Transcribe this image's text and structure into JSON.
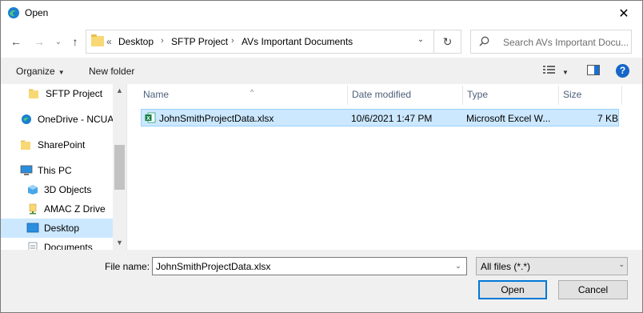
{
  "window": {
    "title": "Open",
    "close_glyph": "✕"
  },
  "nav": {
    "back_glyph": "←",
    "forward_glyph": "→",
    "recent_glyph": "⌄",
    "up_glyph": "↑",
    "breadcrumb_overflow": "«",
    "breadcrumbs": [
      "Desktop",
      "SFTP Project",
      "AVs Important Documents"
    ],
    "separator_glyph": "›",
    "dropdown_glyph": "⌄",
    "refresh_glyph": "↻"
  },
  "search": {
    "placeholder": "Search AVs Important Docu..."
  },
  "toolbar": {
    "organize_label": "Organize",
    "organize_caret": "▼",
    "new_folder_label": "New folder",
    "view_caret": "▼",
    "help_glyph": "?"
  },
  "sidebar": {
    "items": [
      {
        "label": "SFTP Project",
        "icon": "folder-icon"
      },
      {
        "label": "OneDrive - NCUA",
        "icon": "onedrive-icon"
      },
      {
        "label": "SharePoint",
        "icon": "folder-icon"
      },
      {
        "label": "This PC",
        "icon": "computer-icon"
      },
      {
        "label": "3D Objects",
        "icon": "3d-objects-icon"
      },
      {
        "label": "AMAC Z Drive",
        "icon": "network-drive-icon"
      },
      {
        "label": "Desktop",
        "icon": "desktop-icon",
        "selected": true
      },
      {
        "label": "Documents",
        "icon": "documents-icon"
      }
    ],
    "scroll_up_glyph": "▲",
    "scroll_down_glyph": "▼"
  },
  "columns": {
    "name": "Name",
    "date_modified": "Date modified",
    "type": "Type",
    "size": "Size",
    "sort_glyph": "^"
  },
  "files": [
    {
      "name": "JohnSmithProjectData.xlsx",
      "date_modified": "10/6/2021 1:47 PM",
      "type": "Microsoft Excel W...",
      "size": "7 KB",
      "icon": "excel-file-icon",
      "selected": true
    }
  ],
  "footer": {
    "file_name_label": "File name:",
    "file_name_value": "JohnSmithProjectData.xlsx",
    "file_type_value": "All files (*.*)",
    "dropdown_glyph": "⌄",
    "open_label": "Open",
    "cancel_label": "Cancel"
  },
  "colors": {
    "accent": "#0078d7",
    "selection": "#cce8ff",
    "selection_border": "#99d1ff",
    "toolbar_bg": "#f0f0f0",
    "column_header_text": "#4c607a"
  }
}
